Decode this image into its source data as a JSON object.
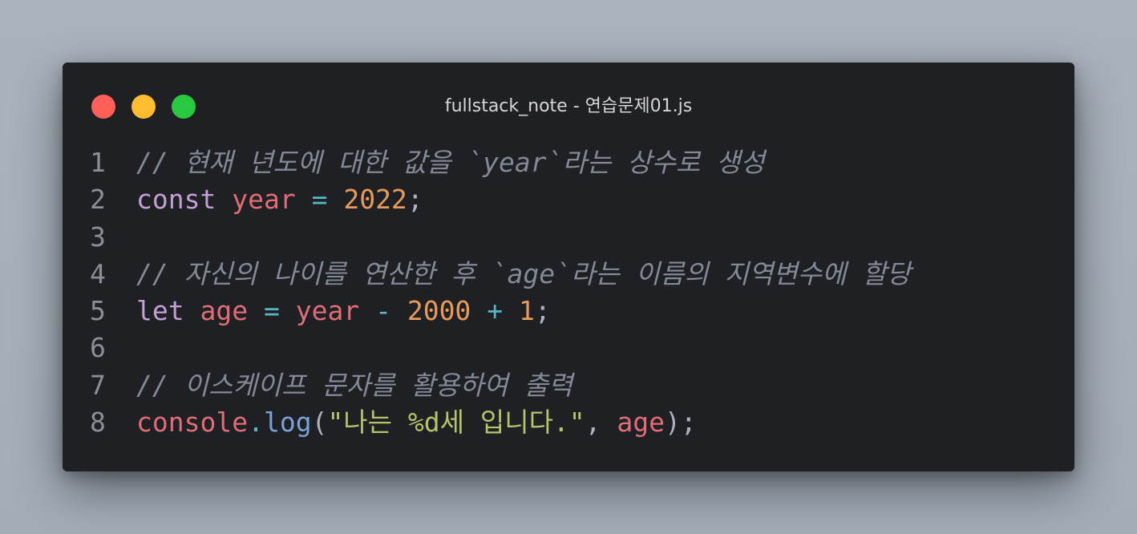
{
  "window": {
    "title": "fullstack_note - 연습문제01.js",
    "buttons": {
      "close_color": "#ff5f57",
      "minimize_color": "#febc2e",
      "maximize_color": "#28c840"
    }
  },
  "code": {
    "lines": [
      {
        "number": "1",
        "tokens": [
          {
            "type": "comment",
            "text": "// 현재 년도에 대한 값을 `year`라는 상수로 생성"
          }
        ]
      },
      {
        "number": "2",
        "tokens": [
          {
            "type": "kw",
            "text": "const"
          },
          {
            "type": "punc",
            "text": " "
          },
          {
            "type": "var",
            "text": "year"
          },
          {
            "type": "punc",
            "text": " "
          },
          {
            "type": "op",
            "text": "="
          },
          {
            "type": "punc",
            "text": " "
          },
          {
            "type": "num",
            "text": "2022"
          },
          {
            "type": "punc",
            "text": ";"
          }
        ]
      },
      {
        "number": "3",
        "tokens": []
      },
      {
        "number": "4",
        "tokens": [
          {
            "type": "comment",
            "text": "// 자신의 나이를 연산한 후 `age`라는 이름의 지역변수에 할당"
          }
        ]
      },
      {
        "number": "5",
        "tokens": [
          {
            "type": "kw",
            "text": "let"
          },
          {
            "type": "punc",
            "text": " "
          },
          {
            "type": "var",
            "text": "age"
          },
          {
            "type": "punc",
            "text": " "
          },
          {
            "type": "op",
            "text": "="
          },
          {
            "type": "punc",
            "text": " "
          },
          {
            "type": "var",
            "text": "year"
          },
          {
            "type": "punc",
            "text": " "
          },
          {
            "type": "op",
            "text": "-"
          },
          {
            "type": "punc",
            "text": " "
          },
          {
            "type": "num",
            "text": "2000"
          },
          {
            "type": "punc",
            "text": " "
          },
          {
            "type": "op",
            "text": "+"
          },
          {
            "type": "punc",
            "text": " "
          },
          {
            "type": "num",
            "text": "1"
          },
          {
            "type": "punc",
            "text": ";"
          }
        ]
      },
      {
        "number": "6",
        "tokens": []
      },
      {
        "number": "7",
        "tokens": [
          {
            "type": "comment",
            "text": "// 이스케이프 문자를 활용하여 출력"
          }
        ]
      },
      {
        "number": "8",
        "tokens": [
          {
            "type": "obj",
            "text": "console"
          },
          {
            "type": "op",
            "text": "."
          },
          {
            "type": "fn",
            "text": "log"
          },
          {
            "type": "punc",
            "text": "("
          },
          {
            "type": "str",
            "text": "\"나는 %d세 입니다.\""
          },
          {
            "type": "punc",
            "text": ", "
          },
          {
            "type": "var",
            "text": "age"
          },
          {
            "type": "punc",
            "text": ");"
          }
        ]
      }
    ]
  },
  "colors": {
    "window_background": "#1f2023",
    "comment": "#828997",
    "keyword": "#c49fd6",
    "variable": "#e06c75",
    "operator": "#56b6c2",
    "number": "#e89a5b",
    "string": "#b5c46a",
    "function": "#7aa2d6",
    "line_number": "#8b8f95"
  }
}
